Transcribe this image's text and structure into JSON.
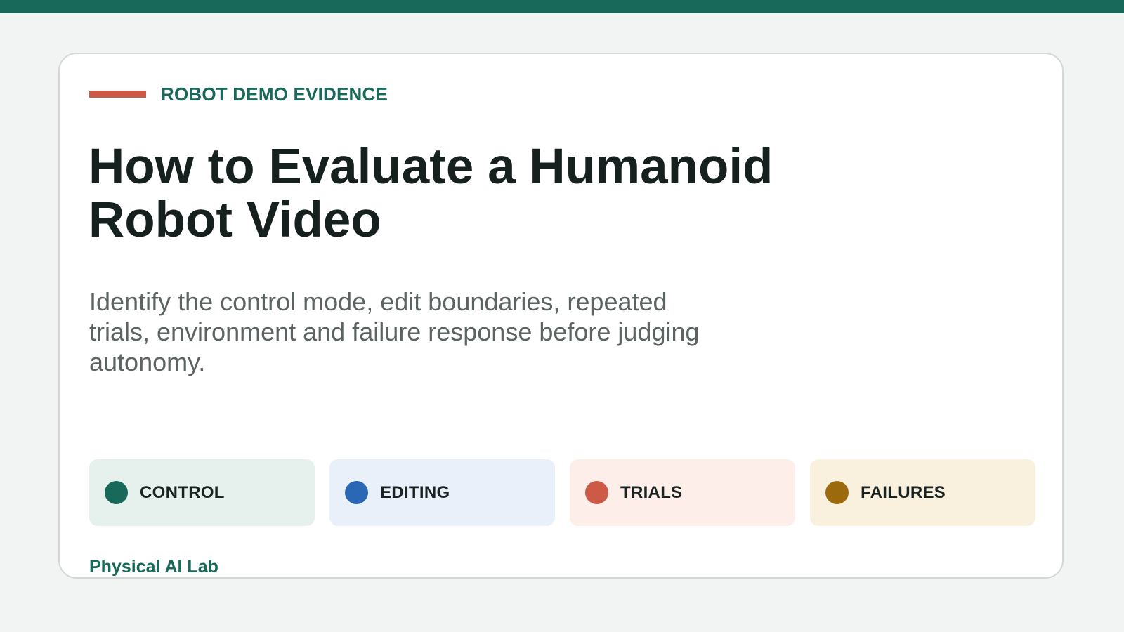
{
  "eyebrow": {
    "label": "ROBOT DEMO EVIDENCE"
  },
  "title": "How to Evaluate a Humanoid Robot Video",
  "subtitle": "Identify the control mode, edit boundaries, repeated trials, environment and failure response before judging autonomy.",
  "chips": [
    {
      "label": "CONTROL",
      "dot_color": "#18695a",
      "bg_color": "#e6f0ec"
    },
    {
      "label": "EDITING",
      "dot_color": "#2a67b5",
      "bg_color": "#e9f0f9"
    },
    {
      "label": "TRIALS",
      "dot_color": "#cc5a47",
      "bg_color": "#fdeeea"
    },
    {
      "label": "FAILURES",
      "dot_color": "#9b6a0c",
      "bg_color": "#f9f1de"
    }
  ],
  "footer": {
    "brand": "Physical AI Lab"
  },
  "colors": {
    "accent": "#18695a",
    "eyebrow_line": "#cc5a47",
    "background": "#f2f4f3",
    "title": "#16201e",
    "subtitle": "#5b6462"
  }
}
